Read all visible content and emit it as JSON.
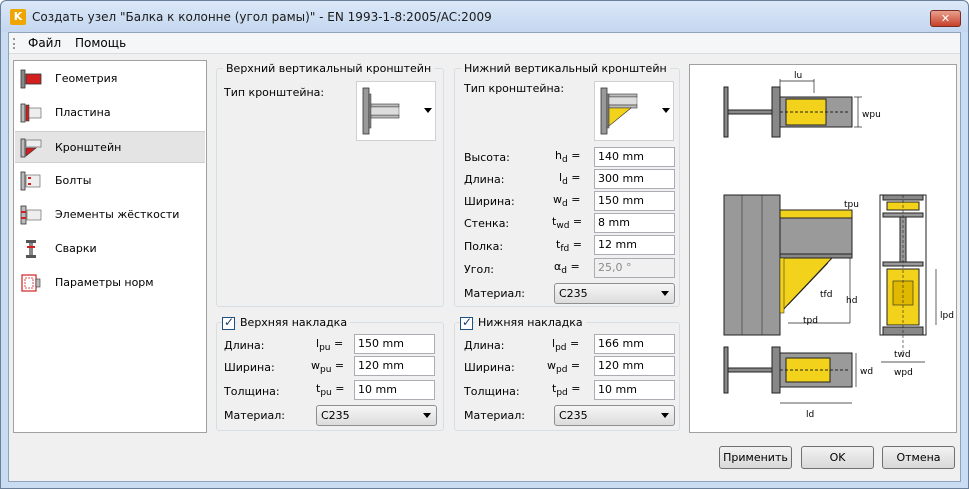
{
  "window": {
    "title": "Создать узел \"Балка к колонне (угол рамы)\" - EN 1993-1-8:2005/AC:2009",
    "app_icon": "K",
    "close_label": "✕"
  },
  "menu": {
    "file": "Файл",
    "help": "Помощь"
  },
  "sidebar": {
    "items": [
      {
        "label": "Геометрия",
        "icon": "geometry-icon"
      },
      {
        "label": "Пластина",
        "icon": "plate-icon"
      },
      {
        "label": "Кронштейн",
        "icon": "bracket-icon"
      },
      {
        "label": "Болты",
        "icon": "bolts-icon"
      },
      {
        "label": "Элементы жёсткости",
        "icon": "stiffeners-icon"
      },
      {
        "label": "Сварки",
        "icon": "welds-icon"
      },
      {
        "label": "Параметры норм",
        "icon": "code-params-icon"
      }
    ],
    "selected": "Кронштейн"
  },
  "upper_bracket": {
    "group_title": "Верхний вертикальный кронштейн",
    "type_label": "Тип кронштейна:"
  },
  "lower_bracket": {
    "group_title": "Нижний вертикальный кронштейн",
    "type_label": "Тип кронштейна:",
    "height": {
      "label": "Высота:",
      "sym": "h",
      "sub": "d",
      "value": "140 mm"
    },
    "length": {
      "label": "Длина:",
      "sym": "l",
      "sub": "d",
      "value": "300 mm"
    },
    "width": {
      "label": "Ширина:",
      "sym": "w",
      "sub": "d",
      "value": "150 mm"
    },
    "web": {
      "label": "Стенка:",
      "sym": "t",
      "sub": "wd",
      "value": "8 mm"
    },
    "flange": {
      "label": "Полка:",
      "sym": "t",
      "sub": "fd",
      "value": "12 mm"
    },
    "angle": {
      "label": "Угол:",
      "sym": "α",
      "sub": "d",
      "value": "25,0 °"
    },
    "material_label": "Материал:",
    "material": "C235"
  },
  "upper_plate": {
    "title": "Верхняя накладка",
    "checked": true,
    "length": {
      "label": "Длина:",
      "sym": "l",
      "sub": "pu",
      "value": "150 mm"
    },
    "width": {
      "label": "Ширина:",
      "sym": "w",
      "sub": "pu",
      "value": "120 mm"
    },
    "thickness": {
      "label": "Толщина:",
      "sym": "t",
      "sub": "pu",
      "value": "10 mm"
    },
    "material_label": "Материал:",
    "material": "C235"
  },
  "lower_plate": {
    "title": "Нижняя накладка",
    "checked": true,
    "length": {
      "label": "Длина:",
      "sym": "l",
      "sub": "pd",
      "value": "166 mm"
    },
    "width": {
      "label": "Ширина:",
      "sym": "w",
      "sub": "pd",
      "value": "120 mm"
    },
    "thickness": {
      "label": "Толщина:",
      "sym": "t",
      "sub": "pd",
      "value": "10 mm"
    },
    "material_label": "Материал:",
    "material": "C235"
  },
  "preview_labels": {
    "lu": "lu",
    "wpu": "wpu",
    "tpu": "tpu",
    "tfd": "tfd",
    "hd": "hd",
    "tpd": "tpd",
    "lpd": "lpd",
    "twd": "twd",
    "wpd": "wpd",
    "wd": "wd",
    "ld": "ld"
  },
  "colors": {
    "steel": "#9e9e9e",
    "plate": "#f2d21b",
    "accent": "#d22020"
  },
  "buttons": {
    "apply": "Применить",
    "ok": "OK",
    "cancel": "Отмена"
  }
}
